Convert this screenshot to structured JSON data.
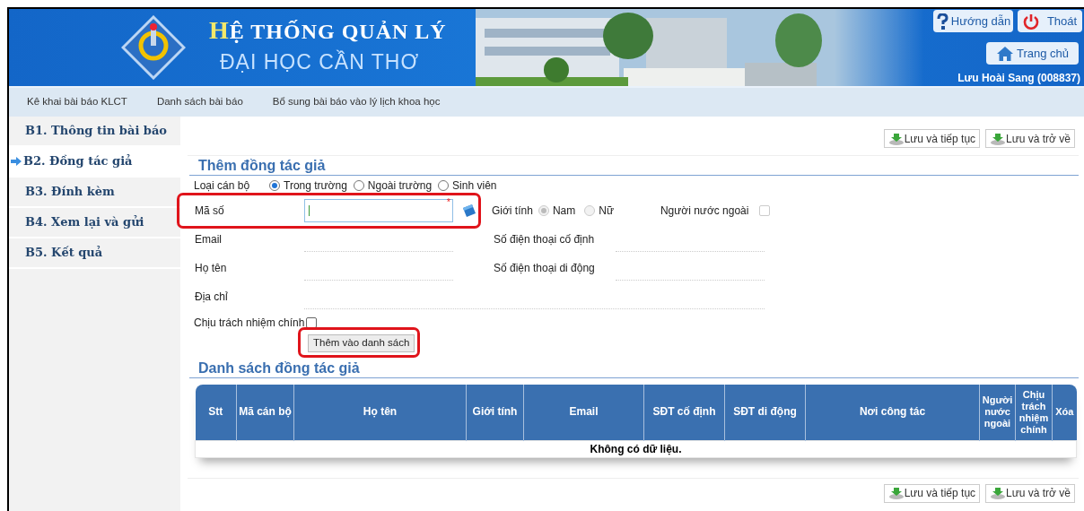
{
  "header": {
    "title": "HỆ THỐNG QUẢN LÝ",
    "subtitle": "ĐẠI HỌC CẦN THƠ",
    "buttons": [
      {
        "label": "Hướng dẫn",
        "kind": "help"
      },
      {
        "label": "Thoát",
        "kind": "logout"
      },
      {
        "label": "Trang chủ",
        "kind": "home"
      }
    ],
    "user": "Lưu Hoài Sang (008837)"
  },
  "nav": [
    "Kê khai bài báo KLCT",
    "Danh sách bài báo",
    "Bổ sung bài báo vào lý lịch khoa học"
  ],
  "steps": [
    {
      "label": "B1. Thông tin bài báo",
      "selected": false
    },
    {
      "label": "B2. Đồng tác giả",
      "selected": true
    },
    {
      "label": "B3. Đính kèm",
      "selected": false
    },
    {
      "label": "B4. Xem lại và gửi",
      "selected": false
    },
    {
      "label": "B5. Kết quả",
      "selected": false
    }
  ],
  "toolbar_top": [
    "Lưu và tiếp tục",
    "Lưu và trở về"
  ],
  "form": {
    "title": "Thêm đồng tác giả",
    "staff_type": {
      "label": "Loại cán bộ",
      "options": [
        {
          "label": "Trong trường",
          "selected": true
        },
        {
          "label": "Ngoài trường",
          "selected": false
        },
        {
          "label": "Sinh viên",
          "selected": false
        }
      ]
    },
    "id_field": {
      "label": "Mã số",
      "required_mark": "*",
      "highlighted": true
    },
    "gender": {
      "label": "Giới tính",
      "disabled": true,
      "options": [
        {
          "label": "Nam",
          "selected": true
        },
        {
          "label": "Nữ",
          "selected": false
        }
      ]
    },
    "foreigner": {
      "label": "Người nước ngoài",
      "checked": false
    },
    "fields": [
      {
        "label": "Email"
      },
      {
        "label": "Số điện thoại cố định"
      },
      {
        "label": "Họ tên"
      },
      {
        "label": "Số điện thoại di động"
      },
      {
        "label": "Địa chỉ"
      }
    ],
    "main_responsible": {
      "label": "Chịu trách nhiệm chính",
      "checked": false
    },
    "add_button": {
      "label": "Thêm vào danh sách",
      "highlighted": true
    }
  },
  "list": {
    "title": "Danh sách đồng tác giả",
    "columns": [
      "Stt",
      "Mã cán bộ",
      "Họ tên",
      "Giới tính",
      "Email",
      "SĐT cố định",
      "SĐT di động",
      "Nơi công tác",
      "Người nước ngoài",
      "Chịu trách nhiệm chính",
      "Xóa"
    ],
    "empty_text": "Không có dữ liệu."
  },
  "toolbar_bottom": [
    "Lưu và tiếp tục",
    "Lưu và trở về"
  ]
}
